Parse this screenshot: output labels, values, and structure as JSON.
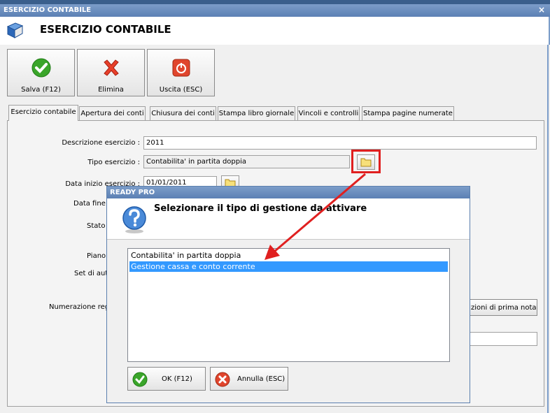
{
  "window": {
    "title": "ESERCIZIO CONTABILE",
    "header_title": "ESERCIZIO CONTABILE",
    "close_glyph": "×"
  },
  "toolbar": {
    "save_label": "Salva (F12)",
    "delete_label": "Elimina",
    "exit_label": "Uscita (ESC)"
  },
  "tabs": [
    {
      "label": "Esercizio contabile",
      "active": true
    },
    {
      "label": "Apertura dei conti"
    },
    {
      "label": "Chiusura dei conti"
    },
    {
      "label": "Stampa libro giornale"
    },
    {
      "label": "Vincoli e controlli"
    },
    {
      "label": "Stampa pagine numerate"
    }
  ],
  "form": {
    "descrizione_label": "Descrizione esercizio :",
    "descrizione_value": "2011",
    "tipo_label": "Tipo esercizio :",
    "tipo_value": "Contabilita' in partita doppia",
    "data_inizio_label": "Data inizio esercizio :",
    "data_inizio_value": "01/01/2011",
    "data_fine_label": "Data fine",
    "stato_label": "Stato",
    "piano_label": "Piano",
    "set_label": "Set di aut",
    "numerazione_label": "Numerazione regi",
    "numerazione_button": "zioni di prima nota"
  },
  "dialog": {
    "title": "READY PRO",
    "message": "Selezionare il tipo di gestione da attivare",
    "options": [
      {
        "label": "Contabilita' in partita doppia",
        "selected": false
      },
      {
        "label": "Gestione cassa e conto corrente",
        "selected": true
      }
    ],
    "ok_label": "OK (F12)",
    "cancel_label": "Annulla (ESC)"
  },
  "icons": {
    "header": "book-icon",
    "save": "check-icon",
    "delete": "red-x-icon",
    "exit": "power-icon",
    "question": "question-icon",
    "folder": "folder-icon"
  },
  "colors": {
    "titlebar": "#5b80b4",
    "selection": "#3399ff",
    "annotation": "#e02020"
  }
}
